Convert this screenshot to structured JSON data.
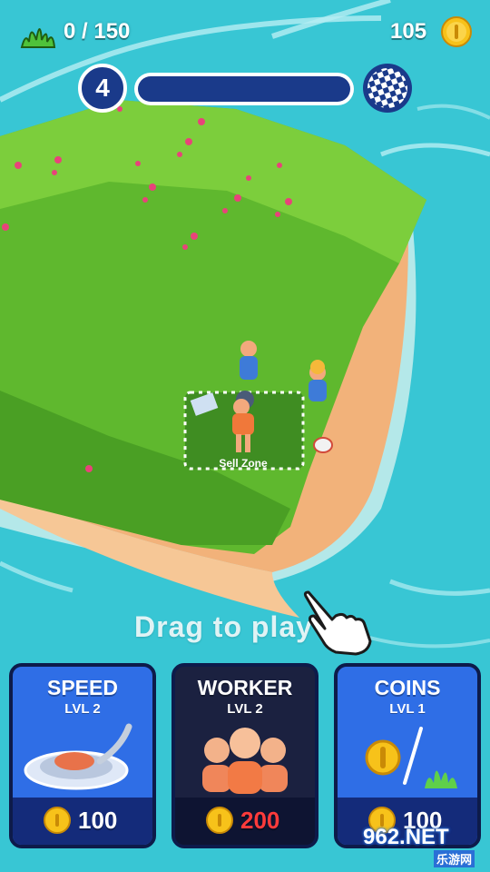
{
  "hud": {
    "grass_count": "0 / 150",
    "coins": "105",
    "level": "4",
    "level_progress": 0.0
  },
  "hint": "Drag to play",
  "zone_label": "Sell Zone",
  "cards": [
    {
      "title": "SPEED",
      "level": "LVL 2",
      "price": "100",
      "style": "blue"
    },
    {
      "title": "WORKER",
      "level": "LVL 2",
      "price": "200",
      "style": "dark",
      "price_color": "red"
    },
    {
      "title": "COINS",
      "level": "LVL 1",
      "price": "100",
      "style": "blue"
    }
  ],
  "watermark": {
    "brand": "962.NET",
    "sub": "乐游网"
  },
  "colors": {
    "sea": "#38c6d4",
    "grass": "#5fb82e",
    "sand": "#f2b27a",
    "card_blue": "#2f6ee6",
    "card_dark": "#1b2140",
    "coin": "#f7c21a"
  }
}
